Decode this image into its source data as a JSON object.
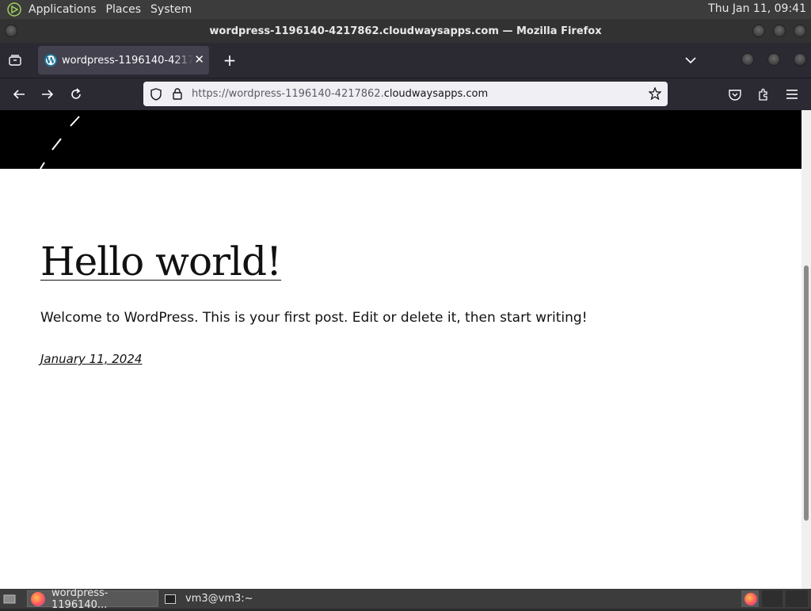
{
  "top_panel": {
    "menus": [
      "Applications",
      "Places",
      "System"
    ],
    "clock": "Thu Jan 11, 09:41"
  },
  "window": {
    "title": "wordpress-1196140-4217862.cloudwaysapps.com — Mozilla Firefox"
  },
  "browser": {
    "tab_title": "wordpress-1196140-4217862.cloudwaysapps.com",
    "url_prefix": "https://wordpress-1196140-4217862.",
    "url_domain": "cloudwaysapps.com"
  },
  "post": {
    "title": "Hello world!",
    "body": "Welcome to WordPress. This is your first post. Edit or delete it, then start writing!",
    "date": "January 11, 2024"
  },
  "taskbar": {
    "items": [
      "wordpress-1196140...",
      "vm3@vm3:~"
    ]
  },
  "colors": {
    "panel": "#3c3c3c",
    "browser_chrome": "#2b2a33",
    "page_bg": "#ffffff",
    "hero_bg": "#000000"
  }
}
